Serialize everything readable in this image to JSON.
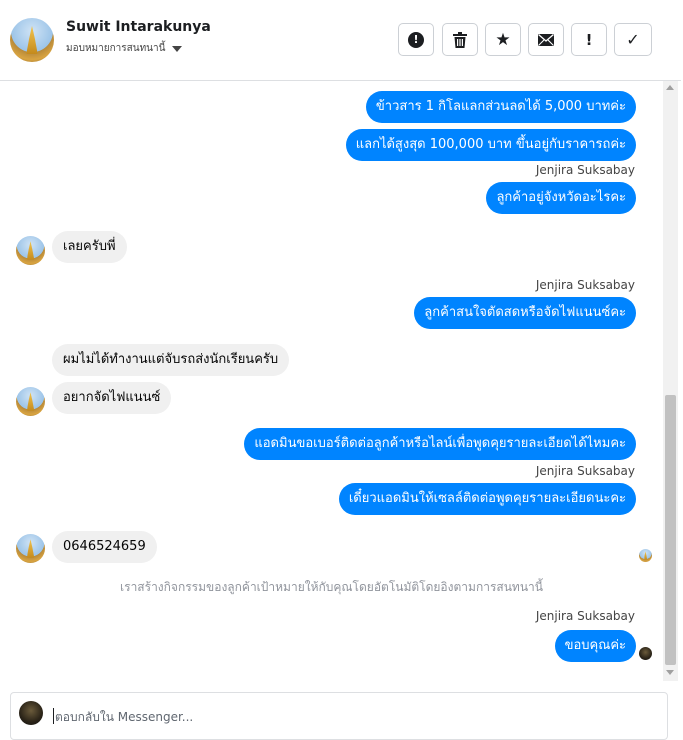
{
  "header": {
    "contact_name": "Suwit Intarakunya",
    "assign_label": "มอบหมายการสนทนานี้",
    "actions": [
      {
        "name": "alert-button",
        "icon": "exclamation-circle-icon",
        "glyph": "!"
      },
      {
        "name": "delete-button",
        "icon": "trash-icon",
        "glyph": "🗑"
      },
      {
        "name": "star-button",
        "icon": "star-icon",
        "glyph": "★"
      },
      {
        "name": "mark-unread-button",
        "icon": "envelope-icon",
        "glyph": "✉"
      },
      {
        "name": "spam-button",
        "icon": "exclamation-icon",
        "glyph": "!"
      },
      {
        "name": "done-button",
        "icon": "check-icon",
        "glyph": "✓"
      }
    ]
  },
  "messages": {
    "m1": "ข้าวสาร 1 กิโลแลกส่วนลดได้ 5,000 บาทค่ะ",
    "m2": "แลกได้สูงสุด 100,000 บาท ขึ้นอยู่กับราคารถค่ะ",
    "m3": "ลูกค้าอยู่จังหวัดอะไรคะ",
    "m4": "เลยครับพี่",
    "m5": "ลูกค้าสนใจตัดสดหรือจัดไฟแนนซ์คะ",
    "m6": "ผมไม่ได้ทำงานแต่จับรถส่งนักเรียนครับ",
    "m7": "อยากจัดไฟแนนซ์",
    "m8": "แอดมินขอเบอร์ติดต่อลูกค้าหรือไลน์เพื่อพูดคุยรายละเอียดได้ไหมคะ",
    "m9": "เดี๋ยวแอดมินให้เซลล์ติดต่อพูดคุยรายละเอียดนะคะ",
    "m10": "0646524659",
    "m11": "ขอบคุณค่ะ"
  },
  "sender_label": "Jenjira Suksabay",
  "system_note": "เราสร้างกิจกรรมของลูกค้าเป้าหมายให้กับคุณโดยอัตโนมัติโดยอิงตามการสนทนานี้",
  "composer": {
    "placeholder": "ตอบกลับใน Messenger..."
  },
  "colors": {
    "outgoing_bubble": "#0084ff",
    "incoming_bubble": "#f0f0f0"
  }
}
